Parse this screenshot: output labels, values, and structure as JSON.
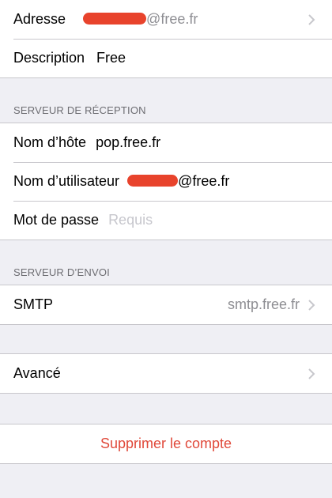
{
  "account": {
    "address_label": "Adresse",
    "address_value_visible": "@free.fr",
    "description_label": "Description",
    "description_value": "Free"
  },
  "incoming": {
    "header": "SERVEUR DE RÉCEPTION",
    "hostname_label": "Nom d’hôte",
    "hostname_value": "pop.free.fr",
    "username_label": "Nom d’utilisateur",
    "username_value_visible": "@free.fr",
    "password_label": "Mot de passe",
    "password_placeholder": "Requis"
  },
  "outgoing": {
    "header": "SERVEUR D’ENVOI",
    "smtp_label": "SMTP",
    "smtp_value": "smtp.free.fr"
  },
  "advanced": {
    "label": "Avancé"
  },
  "delete": {
    "label": "Supprimer le compte"
  },
  "colors": {
    "background": "#efeff4",
    "separator": "#c8c7cc",
    "destructive": "#e0493a",
    "redaction": "#e8432c"
  },
  "icons": {
    "disclosure": "chevron-right-icon"
  }
}
